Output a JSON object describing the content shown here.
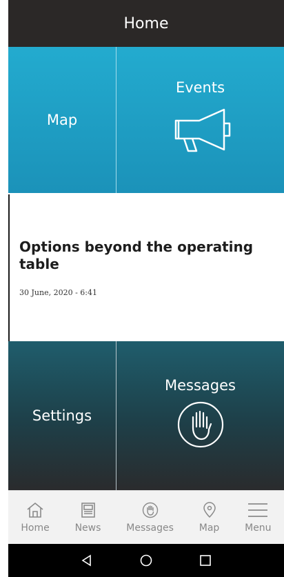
{
  "header": {
    "title": "Home"
  },
  "tiles": {
    "map": "Map",
    "events": "Events",
    "settings": "Settings",
    "messages": "Messages"
  },
  "news": {
    "title": "Options beyond the operating table",
    "date": "30 June, 2020 - 6:41"
  },
  "bottom_nav": [
    {
      "label": "Home",
      "icon": "home-icon"
    },
    {
      "label": "News",
      "icon": "news-icon"
    },
    {
      "label": "Messages",
      "icon": "hand-icon"
    },
    {
      "label": "Map",
      "icon": "location-pin-icon"
    },
    {
      "label": "Menu",
      "icon": "menu-icon"
    }
  ],
  "system_nav": [
    "back-icon",
    "home-circle-icon",
    "recents-icon"
  ],
  "colors": {
    "appbar": "#2b2827",
    "tile_blue": "#1b92b9",
    "tile_dark": "#1e3f48"
  }
}
